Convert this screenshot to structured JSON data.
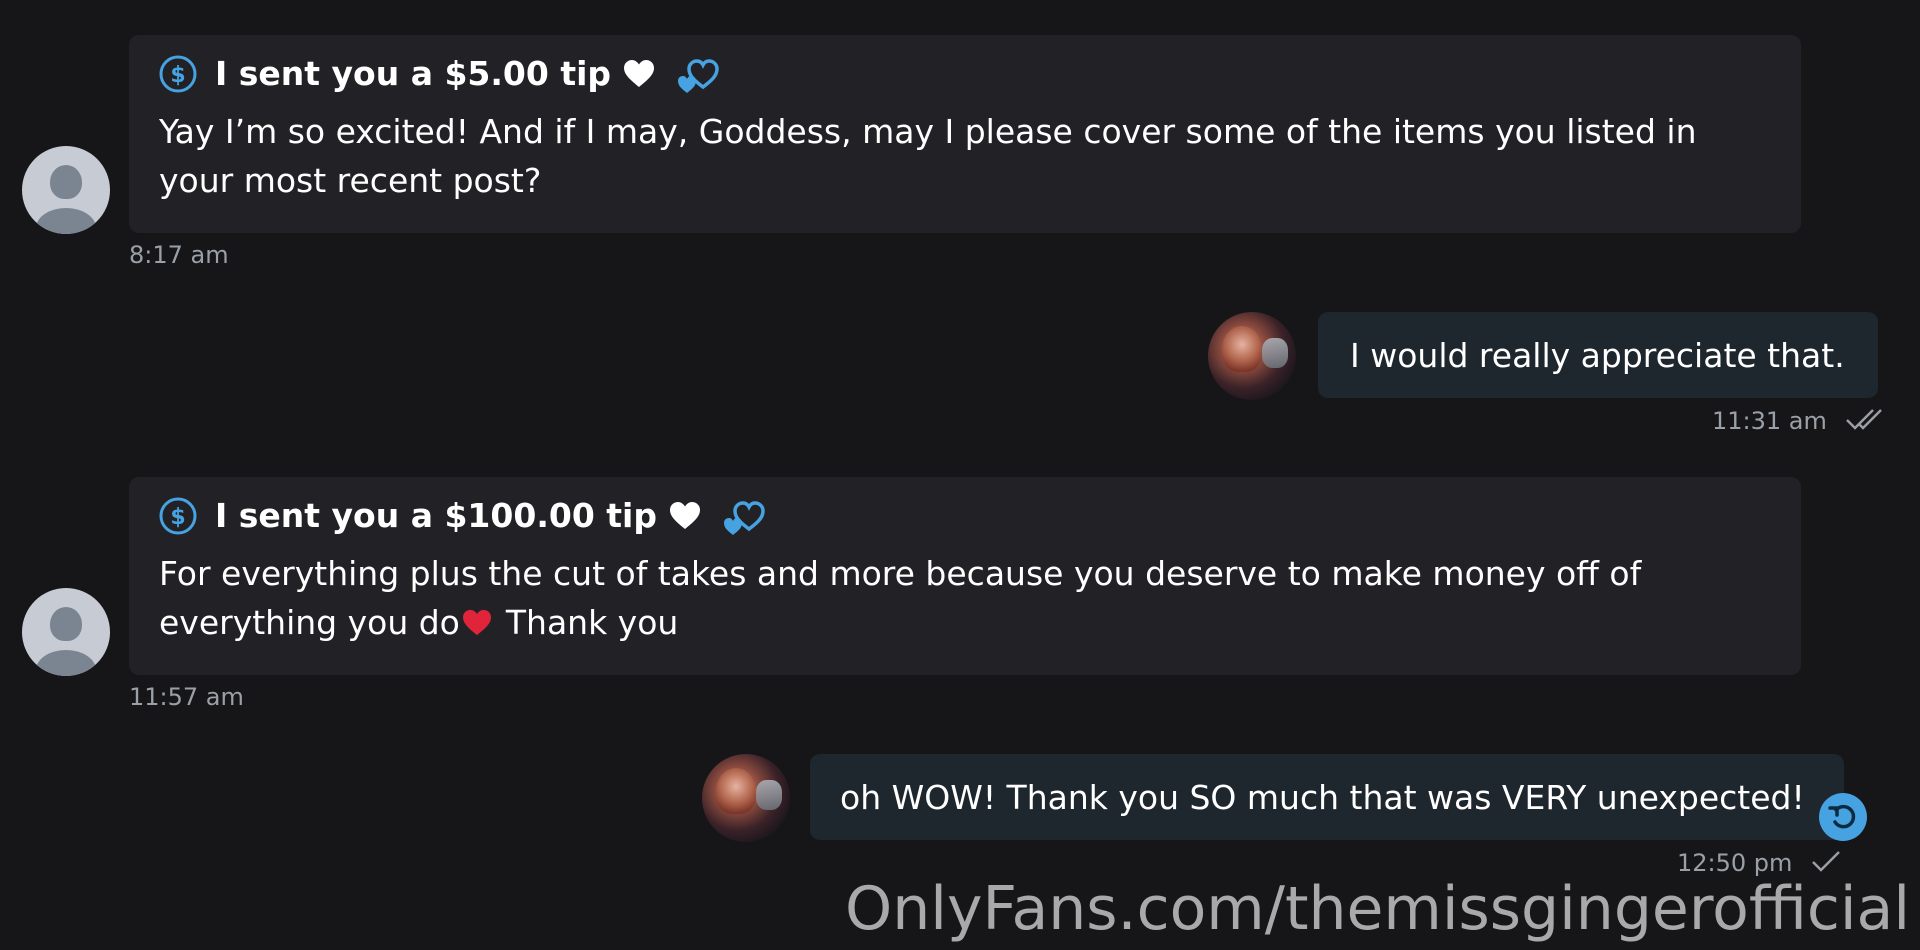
{
  "messages": [
    {
      "tip": "I sent you a $5.00 tip",
      "text": "Yay I’m so excited! And if I may, Goddess, may I please cover some of the items you listed in\nyour most recent post?",
      "time": "8:17 am"
    },
    {
      "text": "I would really appreciate that.",
      "time": "11:31 am"
    },
    {
      "tip": "I sent you a $100.00 tip",
      "text_before_emoji": "For everything plus the cut of takes and more because you deserve to make money off of\neverything you do",
      "text_after_emoji": "Thank you",
      "time": "11:57 am"
    },
    {
      "text": "oh WOW! Thank you SO much that was VERY unexpected!",
      "time": "12:50 pm"
    }
  ],
  "watermark": "OnlyFans.com/themissgingerofficial",
  "colors": {
    "background": "#161618",
    "incoming_bubble": "#222226",
    "outgoing_bubble": "#1e262e",
    "accent": "#46a2e0",
    "timestamp": "#9aa0a6"
  },
  "icons": [
    "dollar-icon",
    "white-heart-icon",
    "double-heart-icon",
    "red-heart-icon",
    "double-check-icon",
    "check-icon",
    "undo-icon"
  ]
}
